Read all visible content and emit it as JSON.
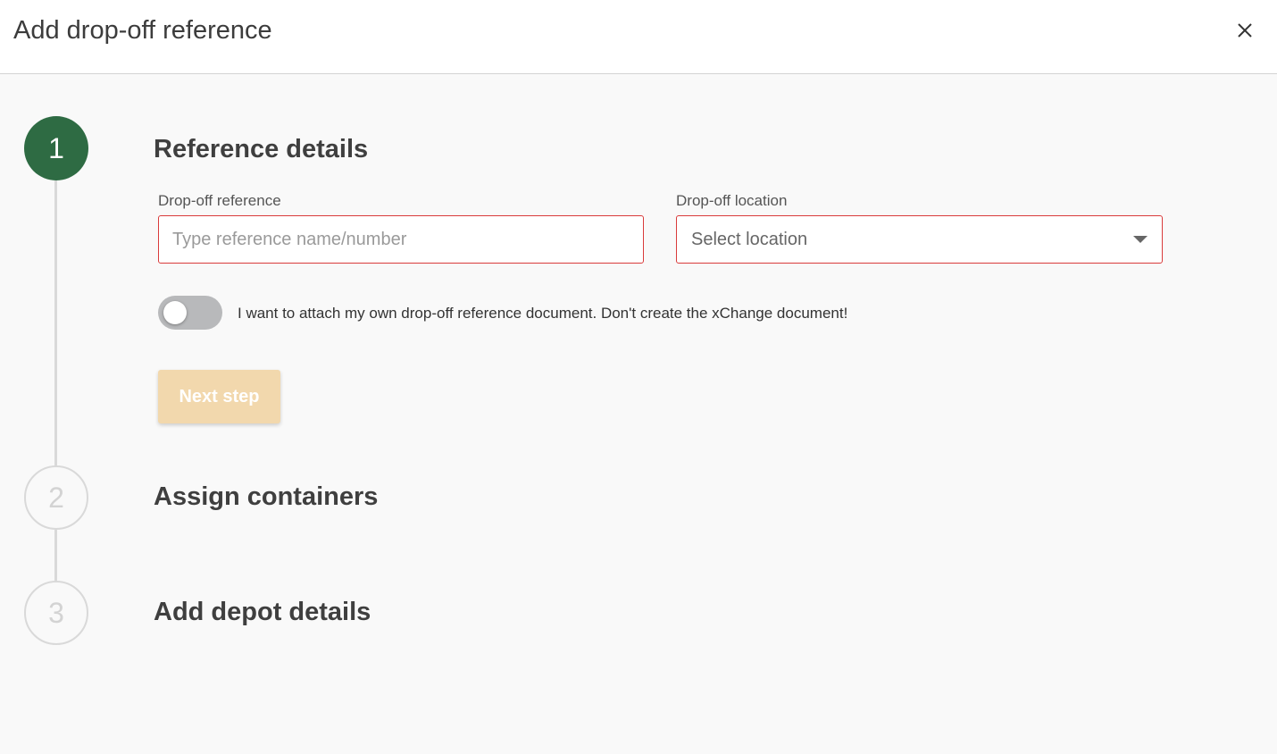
{
  "dialog": {
    "title": "Add drop-off reference",
    "close_icon": "close-icon"
  },
  "steps": [
    {
      "number": "1",
      "title": "Reference details",
      "state": "active"
    },
    {
      "number": "2",
      "title": "Assign containers",
      "state": "inactive"
    },
    {
      "number": "3",
      "title": "Add depot details",
      "state": "inactive"
    }
  ],
  "form": {
    "reference": {
      "label": "Drop-off reference",
      "placeholder": "Type reference name/number",
      "value": ""
    },
    "location": {
      "label": "Drop-off location",
      "selected": "Select location"
    },
    "toggle": {
      "label": "I want to attach my own drop-off reference document. Don't create the xChange document!",
      "checked": false
    },
    "next_button": "Next step"
  },
  "colors": {
    "active_step": "#2e6b43",
    "error_border": "#d93b3b",
    "disabled_button": "#f2d8ad"
  }
}
